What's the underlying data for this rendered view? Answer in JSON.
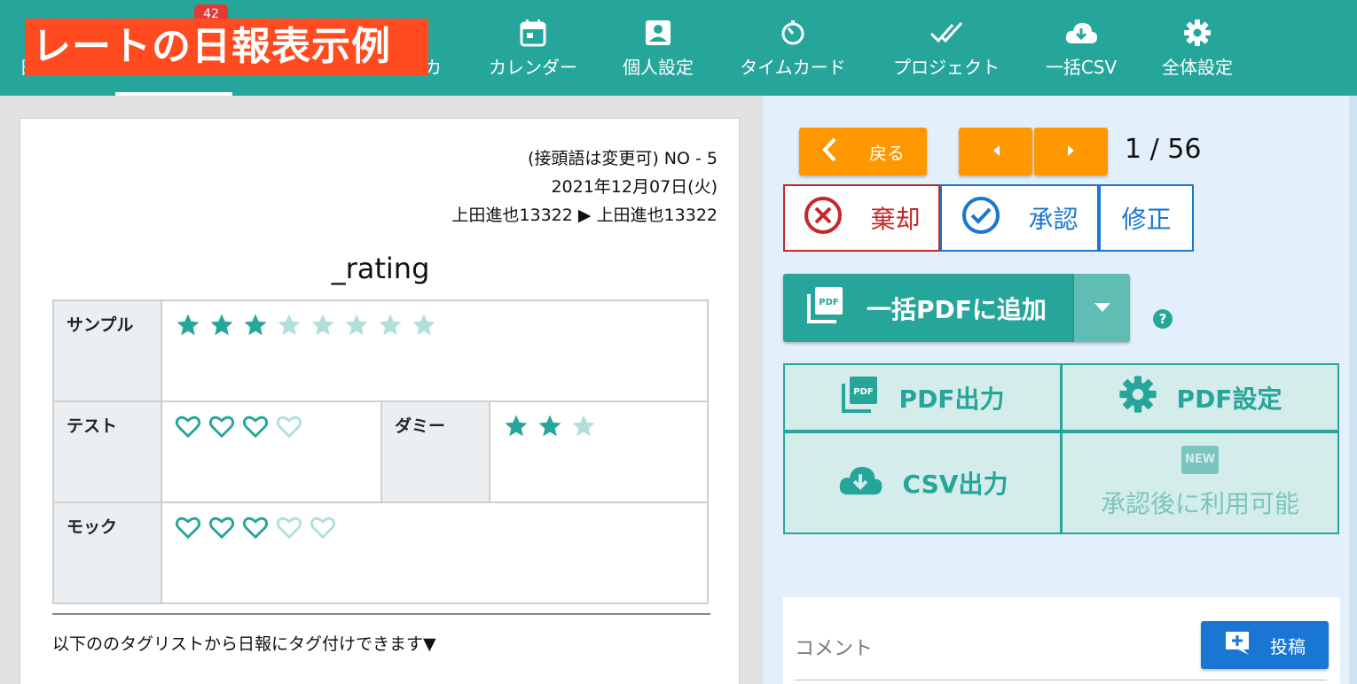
{
  "overlay": {
    "title": "レートの日報表示例"
  },
  "nav": {
    "badge": "42",
    "partial_left": "日",
    "partial_right": "カ",
    "items": [
      {
        "label": "カレンダー",
        "icon": "calendar-icon"
      },
      {
        "label": "個人設定",
        "icon": "account-box-icon"
      },
      {
        "label": "タイムカード",
        "icon": "timer-icon"
      },
      {
        "label": "プロジェクト",
        "icon": "double-check-icon"
      },
      {
        "label": "一括CSV",
        "icon": "cloud-download-icon"
      },
      {
        "label": "全体設定",
        "icon": "gear-icon"
      }
    ]
  },
  "report": {
    "number": "(接頭語は変更可) NO - 5",
    "date": "2021年12月07日(火)",
    "route": "上田進也13322 ▶ 上田進也13322",
    "title": "_rating",
    "rows": [
      {
        "label": "サンプル",
        "type": "star",
        "value": 3,
        "max": 8
      },
      {
        "label": "テスト",
        "type": "heart",
        "value": 3,
        "max": 4
      },
      {
        "label": "ダミー",
        "type": "star",
        "value": 2,
        "max": 3
      },
      {
        "label": "モック",
        "type": "heart",
        "value": 3,
        "max": 5
      }
    ],
    "tag_note": "以下ののタグリストから日報にタグ付けできます▼"
  },
  "actions": {
    "back": "戻る",
    "pager": "1 / 56",
    "reject": "棄却",
    "approve": "承認",
    "fix": "修正",
    "pdf_add": "一括PDFに追加",
    "help": "?",
    "pdf_output": "PDF出力",
    "pdf_settings": "PDF設定",
    "csv_output": "CSV出力",
    "after_approval": "承認後に利用可能",
    "new_badge": "NEW"
  },
  "comment": {
    "placeholder": "コメント",
    "post": "投稿"
  },
  "colors": {
    "teal": "#26a69a",
    "orange": "#ff9800",
    "red": "#c62828",
    "blue": "#1976d2",
    "light_teal": "#b2dfdb"
  }
}
